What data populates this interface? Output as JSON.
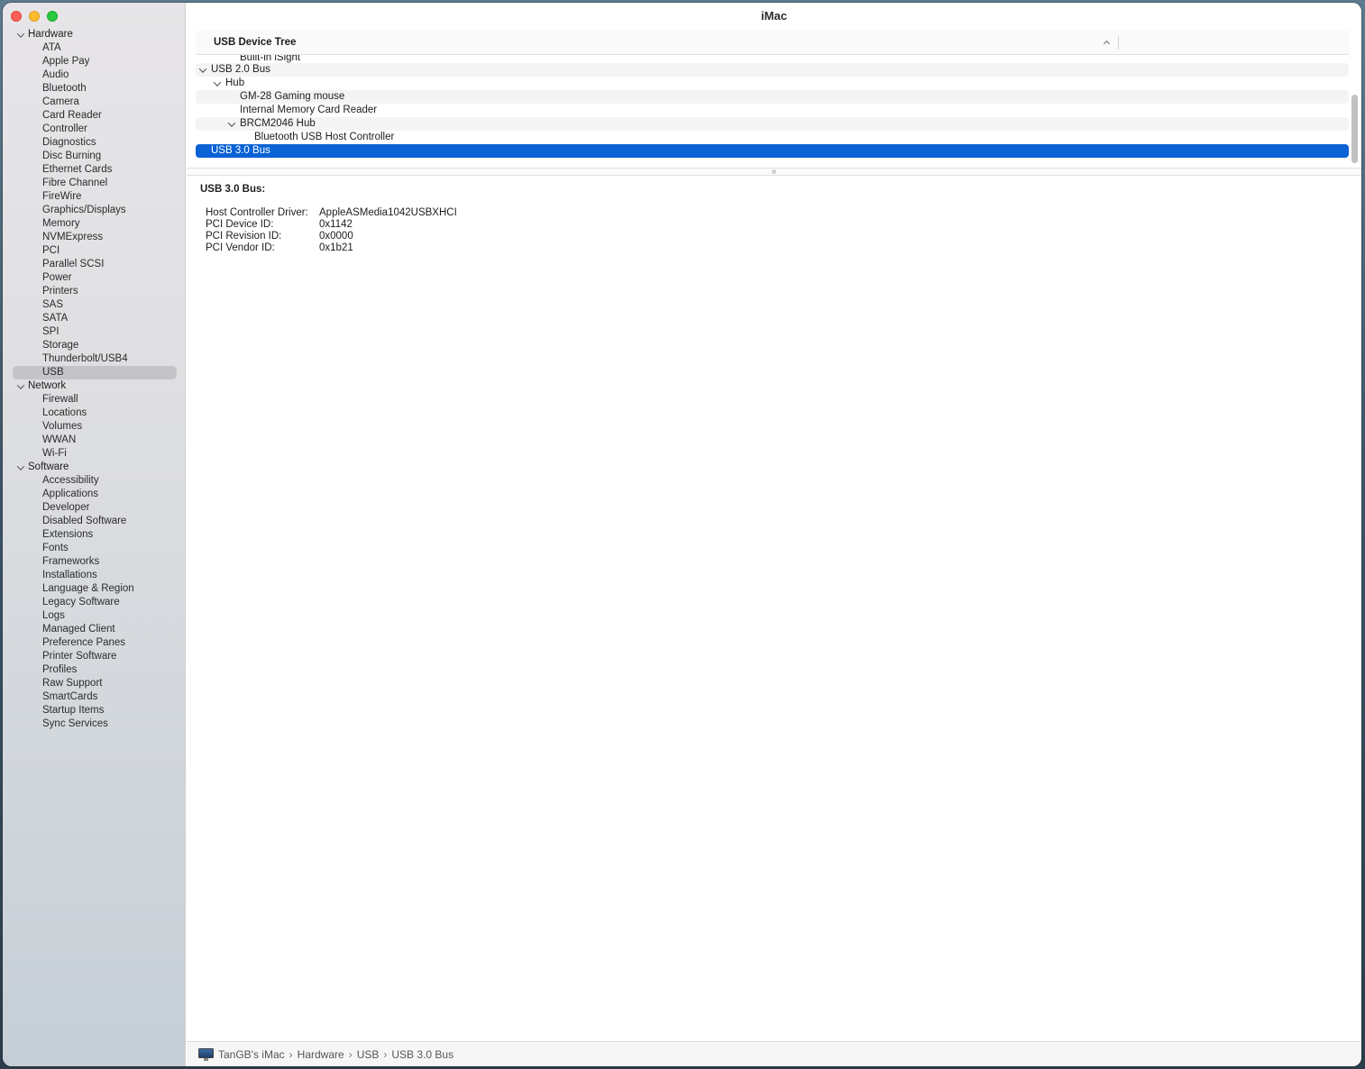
{
  "window": {
    "title": "iMac"
  },
  "sidebar": {
    "groups": [
      {
        "label": "Hardware",
        "items": [
          "ATA",
          "Apple Pay",
          "Audio",
          "Bluetooth",
          "Camera",
          "Card Reader",
          "Controller",
          "Diagnostics",
          "Disc Burning",
          "Ethernet Cards",
          "Fibre Channel",
          "FireWire",
          "Graphics/Displays",
          "Memory",
          "NVMExpress",
          "PCI",
          "Parallel SCSI",
          "Power",
          "Printers",
          "SAS",
          "SATA",
          "SPI",
          "Storage",
          "Thunderbolt/USB4",
          "USB"
        ]
      },
      {
        "label": "Network",
        "items": [
          "Firewall",
          "Locations",
          "Volumes",
          "WWAN",
          "Wi-Fi"
        ]
      },
      {
        "label": "Software",
        "items": [
          "Accessibility",
          "Applications",
          "Developer",
          "Disabled Software",
          "Extensions",
          "Fonts",
          "Frameworks",
          "Installations",
          "Language & Region",
          "Legacy Software",
          "Logs",
          "Managed Client",
          "Preference Panes",
          "Printer Software",
          "Profiles",
          "Raw Support",
          "SmartCards",
          "Startup Items",
          "Sync Services"
        ]
      }
    ],
    "selected": "USB"
  },
  "usb_tree": {
    "column_header": "USB Device Tree",
    "rows": [
      {
        "label": "Built-in iSight",
        "level": 2,
        "expandable": false,
        "partial": true
      },
      {
        "label": "USB 2.0 Bus",
        "level": 0,
        "expandable": true
      },
      {
        "label": "Hub",
        "level": 1,
        "expandable": true
      },
      {
        "label": "GM-28 Gaming mouse",
        "level": 2,
        "expandable": false
      },
      {
        "label": "Internal Memory Card Reader",
        "level": 2,
        "expandable": false
      },
      {
        "label": "BRCM2046 Hub",
        "level": 2,
        "expandable": true
      },
      {
        "label": "Bluetooth USB Host Controller",
        "level": 3,
        "expandable": false
      },
      {
        "label": "USB 3.0 Bus",
        "level": 0,
        "expandable": false,
        "selected": true
      }
    ]
  },
  "detail": {
    "title": "USB 3.0 Bus:",
    "fields": [
      {
        "key": "Host Controller Driver:",
        "value": "AppleASMedia1042USBXHCI"
      },
      {
        "key": "PCI Device ID:",
        "value": "0x1142"
      },
      {
        "key": "PCI Revision ID:",
        "value": "0x0000"
      },
      {
        "key": "PCI Vendor ID:",
        "value": "0x1b21"
      }
    ]
  },
  "statusbar": {
    "icon": "imac-icon",
    "path": [
      "TanGB's iMac",
      "Hardware",
      "USB",
      "USB 3.0 Bus"
    ]
  },
  "colors": {
    "selection": "#0a62d5",
    "sidebar_selection": "#c4c4c8"
  }
}
